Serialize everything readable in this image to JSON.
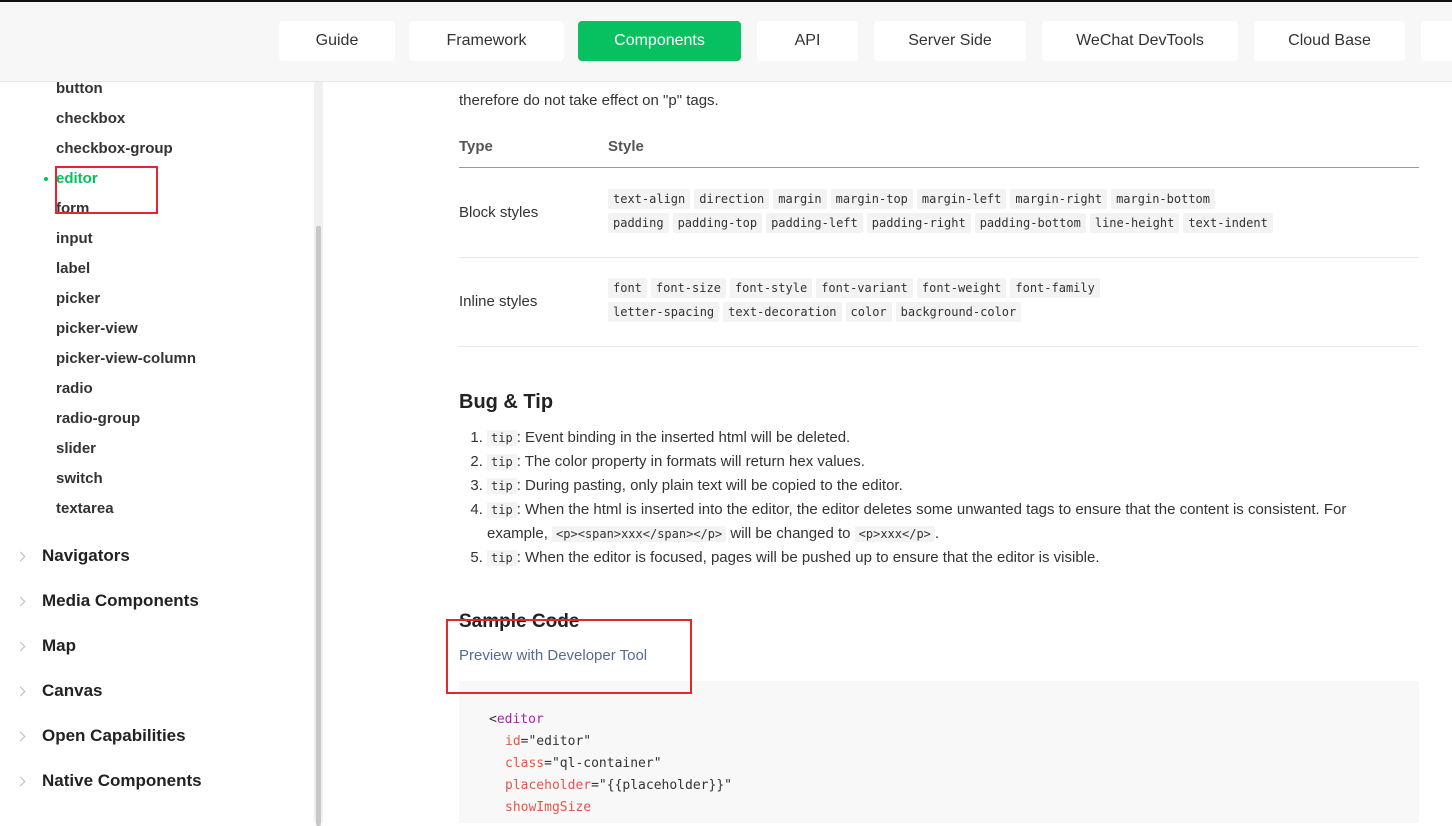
{
  "topnav": {
    "tabs": [
      {
        "label": "Guide",
        "active": false
      },
      {
        "label": "Framework",
        "active": false
      },
      {
        "label": "Components",
        "active": true
      },
      {
        "label": "API",
        "active": false
      },
      {
        "label": "Server Side",
        "active": false
      },
      {
        "label": "WeChat DevTools",
        "active": false
      },
      {
        "label": "Cloud Base",
        "active": false
      }
    ],
    "accent_color": "#07c160"
  },
  "sidebar": {
    "items": [
      {
        "label": "button"
      },
      {
        "label": "checkbox"
      },
      {
        "label": "checkbox-group"
      },
      {
        "label": "editor",
        "active": true
      },
      {
        "label": "form"
      },
      {
        "label": "input"
      },
      {
        "label": "label"
      },
      {
        "label": "picker"
      },
      {
        "label": "picker-view"
      },
      {
        "label": "picker-view-column"
      },
      {
        "label": "radio"
      },
      {
        "label": "radio-group"
      },
      {
        "label": "slider"
      },
      {
        "label": "switch"
      },
      {
        "label": "textarea"
      }
    ],
    "groups": [
      {
        "label": "Navigators"
      },
      {
        "label": "Media Components"
      },
      {
        "label": "Map"
      },
      {
        "label": "Canvas"
      },
      {
        "label": "Open Capabilities"
      },
      {
        "label": "Native Components"
      }
    ]
  },
  "content": {
    "intro_tail": "therefore do not take effect on \"p\" tags.",
    "table": {
      "headers": [
        "Type",
        "Style"
      ],
      "rows": [
        {
          "type": "Block styles",
          "styles": [
            [
              "text-align",
              "direction",
              "margin",
              "margin-top",
              "margin-left",
              "margin-right",
              "margin-bottom"
            ],
            [
              "padding",
              "padding-top",
              "padding-left",
              "padding-right",
              "padding-bottom",
              "line-height",
              "text-indent"
            ]
          ]
        },
        {
          "type": "Inline styles",
          "styles": [
            [
              "font",
              "font-size",
              "font-style",
              "font-variant",
              "font-weight",
              "font-family"
            ],
            [
              "letter-spacing",
              "text-decoration",
              "color",
              "background-color"
            ]
          ]
        }
      ]
    },
    "bug_tip": {
      "title": "Bug & Tip",
      "tag": "tip",
      "items": [
        {
          "before": ": Event binding in the inserted html will be deleted."
        },
        {
          "before": ": The color property in formats will return hex values."
        },
        {
          "before": ": During pasting, only plain text will be copied to the editor."
        },
        {
          "before": ": When the html is inserted into the editor, the editor deletes some unwanted tags to ensure that the content is consistent. For example,",
          "code1": "<p><span>xxx</span></p>",
          "middle": "will be changed to",
          "code2": "<p>xxx</p>",
          "after": "."
        },
        {
          "before": ": When the editor is focused, pages will be pushed up to ensure that the editor is visible."
        }
      ]
    },
    "sample": {
      "title": "Sample Code",
      "preview_link": "Preview with Developer Tool",
      "code": {
        "open": "<",
        "tag": "editor",
        "attrs": [
          {
            "name": "id",
            "value": "=\"editor\""
          },
          {
            "name": "class",
            "value": "=\"ql-container\""
          },
          {
            "name": "placeholder",
            "value": "=\"{{placeholder}}\""
          },
          {
            "name": "showImgSize",
            "value": ""
          }
        ]
      }
    }
  }
}
